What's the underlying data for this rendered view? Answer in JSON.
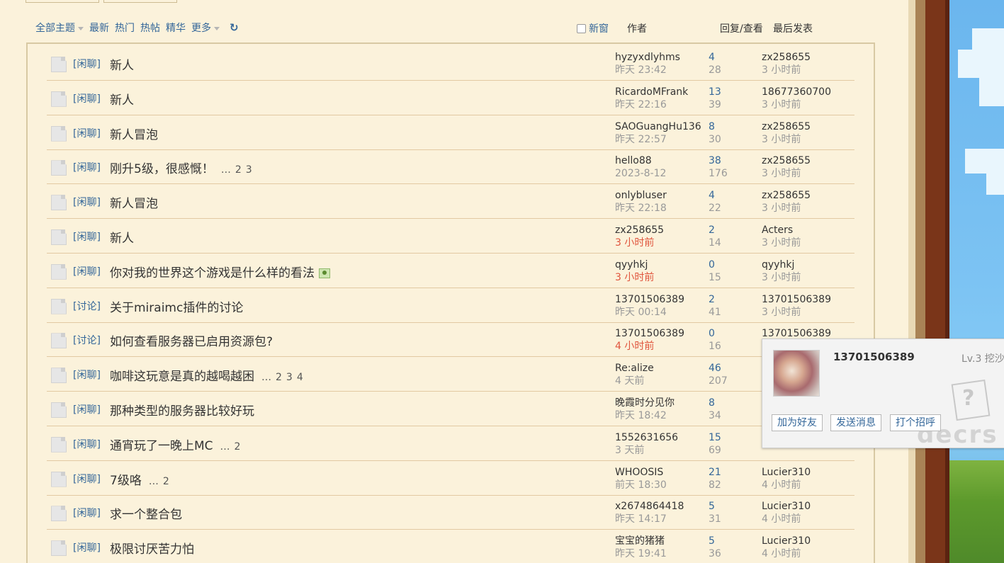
{
  "filter_bar": {
    "items": [
      {
        "label": "全部主题",
        "dropdown": true
      },
      {
        "label": "最新",
        "dropdown": false
      },
      {
        "label": "热门",
        "dropdown": false
      },
      {
        "label": "热帖",
        "dropdown": false
      },
      {
        "label": "精华",
        "dropdown": false
      },
      {
        "label": "更多",
        "dropdown": true
      }
    ],
    "refresh_icon": "refresh-icon"
  },
  "header": {
    "new_window": "新窗",
    "author": "作者",
    "replies_views": "回复/查看",
    "last_post": "最后发表"
  },
  "threads": [
    {
      "type": "[闲聊]",
      "title": "新人",
      "pages": [],
      "attachment": false,
      "author": "hyzyxdlyhms",
      "post_time": "昨天 23:42",
      "post_time_hot": false,
      "replies": "4",
      "views": "28",
      "last_user": "zx258655",
      "last_time": "3 小时前"
    },
    {
      "type": "[闲聊]",
      "title": "新人",
      "pages": [],
      "attachment": false,
      "author": "RicardoMFrank",
      "post_time": "昨天 22:16",
      "post_time_hot": false,
      "replies": "13",
      "views": "39",
      "last_user": "18677360700",
      "last_time": "3 小时前"
    },
    {
      "type": "[闲聊]",
      "title": "新人冒泡",
      "pages": [],
      "attachment": false,
      "author": "SAOGuangHu136",
      "post_time": "昨天 22:57",
      "post_time_hot": false,
      "replies": "8",
      "views": "30",
      "last_user": "zx258655",
      "last_time": "3 小时前"
    },
    {
      "type": "[闲聊]",
      "title": "刚升5级，很感慨！",
      "pages": [
        "2",
        "3"
      ],
      "attachment": false,
      "author": "hello88",
      "post_time": "2023-8-12",
      "post_time_hot": false,
      "replies": "38",
      "views": "176",
      "last_user": "zx258655",
      "last_time": "3 小时前"
    },
    {
      "type": "[闲聊]",
      "title": "新人冒泡",
      "pages": [],
      "attachment": false,
      "author": "onlybluser",
      "post_time": "昨天 22:18",
      "post_time_hot": false,
      "replies": "4",
      "views": "22",
      "last_user": "zx258655",
      "last_time": "3 小时前"
    },
    {
      "type": "[闲聊]",
      "title": "新人",
      "pages": [],
      "attachment": false,
      "author": "zx258655",
      "post_time": "3 小时前",
      "post_time_hot": true,
      "replies": "2",
      "views": "14",
      "last_user": "Acters",
      "last_time": "3 小时前"
    },
    {
      "type": "[闲聊]",
      "title": "你对我的世界这个游戏是什么样的看法",
      "pages": [],
      "attachment": true,
      "author": "qyyhkj",
      "post_time": "3 小时前",
      "post_time_hot": true,
      "replies": "0",
      "views": "15",
      "last_user": "qyyhkj",
      "last_time": "3 小时前"
    },
    {
      "type": "[讨论]",
      "title": "关于miraimc插件的讨论",
      "pages": [],
      "attachment": false,
      "author": "13701506389",
      "post_time": "昨天 00:14",
      "post_time_hot": false,
      "replies": "2",
      "views": "41",
      "last_user": "13701506389",
      "last_time": "3 小时前"
    },
    {
      "type": "[讨论]",
      "title": "如何查看服务器已启用资源包?",
      "pages": [],
      "attachment": false,
      "author": "13701506389",
      "post_time": "4 小时前",
      "post_time_hot": true,
      "replies": "0",
      "views": "16",
      "last_user": "13701506389",
      "last_time": ""
    },
    {
      "type": "[闲聊]",
      "title": "咖啡这玩意是真的越喝越困",
      "pages": [
        "2",
        "3",
        "4"
      ],
      "attachment": false,
      "author": "Re:alize",
      "post_time": "4 天前",
      "post_time_hot": false,
      "replies": "46",
      "views": "207",
      "last_user": "",
      "last_time": ""
    },
    {
      "type": "[闲聊]",
      "title": "那种类型的服务器比较好玩",
      "pages": [],
      "attachment": false,
      "author": "晚霞时分见你",
      "post_time": "昨天 18:42",
      "post_time_hot": false,
      "replies": "8",
      "views": "34",
      "last_user": "",
      "last_time": ""
    },
    {
      "type": "[闲聊]",
      "title": "通宵玩了一晚上MC",
      "pages": [
        "2"
      ],
      "attachment": false,
      "author": "1552631656",
      "post_time": "3 天前",
      "post_time_hot": false,
      "replies": "15",
      "views": "69",
      "last_user": "",
      "last_time": "4 小时前"
    },
    {
      "type": "[闲聊]",
      "title": "7级咯",
      "pages": [
        "2"
      ],
      "attachment": false,
      "author": "WHOOSIS",
      "post_time": "前天 18:30",
      "post_time_hot": false,
      "replies": "21",
      "views": "82",
      "last_user": "Lucier310",
      "last_time": "4 小时前"
    },
    {
      "type": "[闲聊]",
      "title": "求一个整合包",
      "pages": [],
      "attachment": false,
      "author": "x2674864418",
      "post_time": "昨天 14:17",
      "post_time_hot": false,
      "replies": "5",
      "views": "31",
      "last_user": "Lucier310",
      "last_time": "4 小时前"
    },
    {
      "type": "[闲聊]",
      "title": "极限讨厌苦力怕",
      "pages": [],
      "attachment": false,
      "author": "宝宝的猪猪",
      "post_time": "昨天 19:41",
      "post_time_hot": false,
      "replies": "5",
      "views": "36",
      "last_user": "Lucier310",
      "last_time": "4 小时前"
    }
  ],
  "popup": {
    "username": "13701506389",
    "level": "Lv.3 挖沙",
    "buttons": {
      "add_friend": "加为好友",
      "send_message": "发送消息",
      "greet": "打个招呼"
    },
    "watermark": "decrs"
  },
  "colors": {
    "link": "#336699",
    "hot_time": "#e0553d",
    "background": "#fbf2db",
    "row_border": "#e2c9a2"
  }
}
